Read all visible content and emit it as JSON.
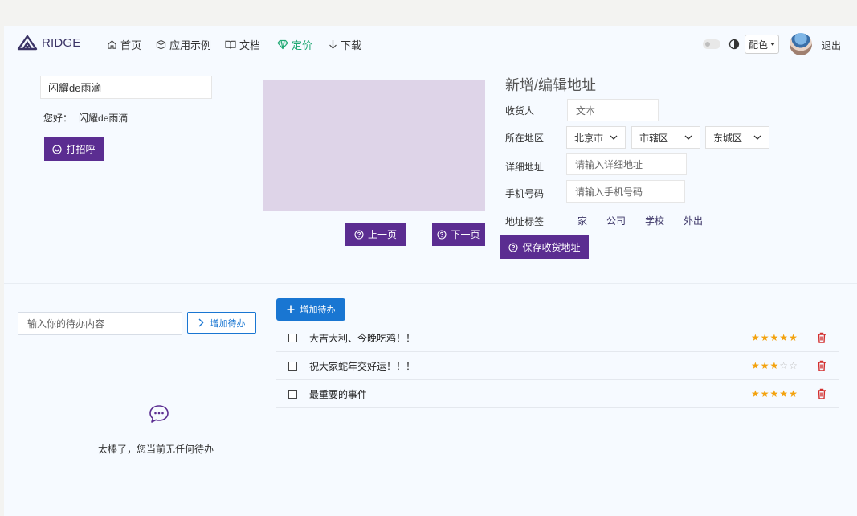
{
  "nav": {
    "logo": "RIDGE",
    "items": [
      {
        "label": "首页",
        "icon": "home-icon"
      },
      {
        "label": "应用示例",
        "icon": "box-icon"
      },
      {
        "label": "文档",
        "icon": "book-icon"
      },
      {
        "label": "定价",
        "icon": "diamond-icon",
        "active": true
      },
      {
        "label": "下载",
        "icon": "download-icon"
      }
    ],
    "color_button": "配色",
    "logout": "退出"
  },
  "greeter": {
    "name_value": "闪耀de雨滴",
    "greeting_prefix": "您好：",
    "greeting_name": "闪耀de雨滴",
    "button": "打招呼"
  },
  "pager": {
    "prev": "上一页",
    "next": "下一页"
  },
  "address_form": {
    "title": "新增/编辑地址",
    "receiver_label": "收货人",
    "receiver_value": "文本",
    "region_label": "所在地区",
    "province": "北京市",
    "city": "市辖区",
    "district": "东城区",
    "detail_label": "详细地址",
    "detail_placeholder": "请输入详细地址",
    "phone_label": "手机号码",
    "phone_placeholder": "请输入手机号码",
    "tag_label": "地址标签",
    "tags": [
      "家",
      "公司",
      "学校",
      "外出"
    ],
    "save_button": "保存收货地址"
  },
  "todo_left": {
    "input_placeholder": "输入你的待办内容",
    "add_button": "增加待办",
    "empty_text": "太棒了，您当前无任何待办"
  },
  "todo_right": {
    "add_button": "增加待办",
    "items": [
      {
        "text": "大吉大利、今晚吃鸡！！",
        "rating": 5
      },
      {
        "text": "祝大家蛇年交好运！！！",
        "rating": 3
      },
      {
        "text": "最重要的事件",
        "rating": 5
      }
    ]
  },
  "colors": {
    "brand_purple": "#5b2d91",
    "accent_blue": "#1976d2",
    "active_green": "#1ea872",
    "star": "#f3a20e",
    "delete_red": "#d32f2f"
  }
}
